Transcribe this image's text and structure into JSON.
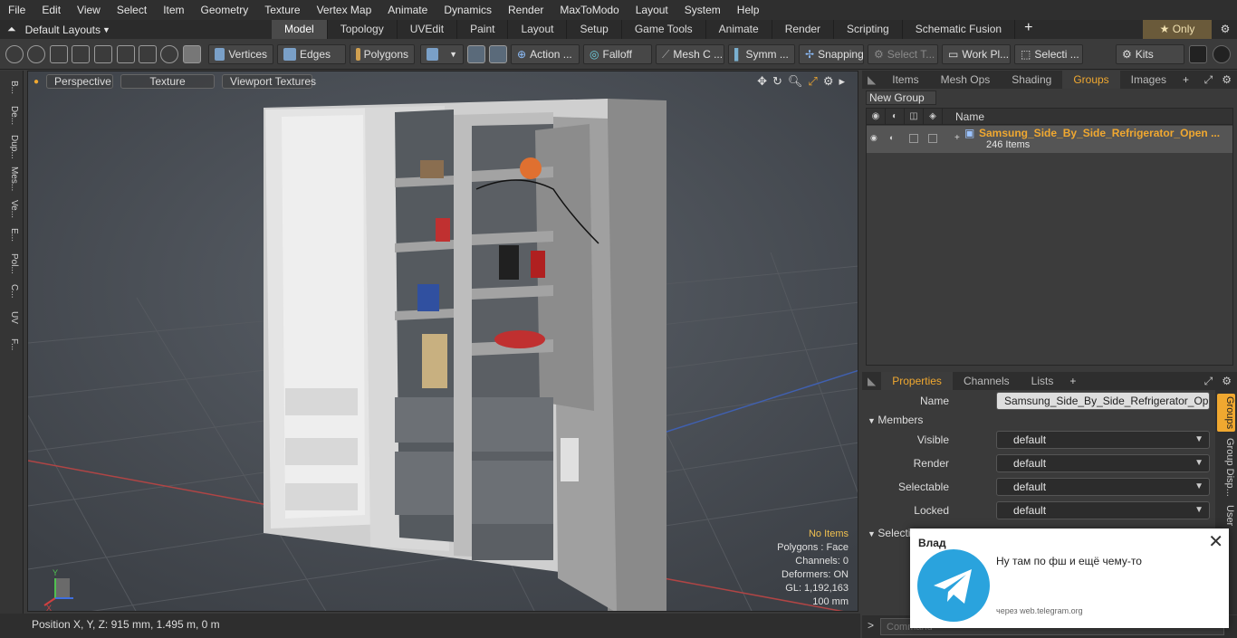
{
  "menu": [
    "File",
    "Edit",
    "View",
    "Select",
    "Item",
    "Geometry",
    "Texture",
    "Vertex Map",
    "Animate",
    "Dynamics",
    "Render",
    "MaxToModo",
    "Layout",
    "System",
    "Help"
  ],
  "layout": {
    "label": "Default Layouts"
  },
  "tabs": [
    "Model",
    "Topology",
    "UVEdit",
    "Paint",
    "Layout",
    "Setup",
    "Game Tools",
    "Animate",
    "Render",
    "Scripting",
    "Schematic Fusion"
  ],
  "only_label": "Only",
  "toolbar": {
    "vertices": "Vertices",
    "edges": "Edges",
    "polygons": "Polygons",
    "action": "Action ...",
    "falloff": "Falloff",
    "meshc": "Mesh C ...",
    "symm": "Symm ...",
    "snapping": "Snapping",
    "select_t": "Select T...",
    "workpl": "Work Pl...",
    "selecti": "Selecti ...",
    "kits": "Kits"
  },
  "left_strip": [
    "B...",
    "De...",
    "Dup...",
    "Mes...",
    "Ve...",
    "E...",
    "Pol...",
    "C...",
    "UV",
    "F..."
  ],
  "viewport": {
    "perspective": "Perspective",
    "texture": "Texture",
    "viewport_textures": "Viewport Textures",
    "info": {
      "no_items": "No Items",
      "polygons": "Polygons : Face",
      "channels": "Channels: 0",
      "deformers": "Deformers: ON",
      "gl": "GL: 1,192,163",
      "scale": "100 mm"
    }
  },
  "right_tabs": [
    "Items",
    "Mesh Ops",
    "Shading",
    "Groups",
    "Images"
  ],
  "new_group": "New Group",
  "group_list": {
    "header_name": "Name",
    "row_name": "Samsung_Side_By_Side_Refrigerator_Open ...",
    "row_count": "246 Items"
  },
  "props_tabs": [
    "Properties",
    "Channels",
    "Lists"
  ],
  "properties": {
    "name_label": "Name",
    "name_value": "Samsung_Side_By_Side_Refrigerator_Open_wi",
    "members_label": "Members",
    "visible_label": "Visible",
    "render_label": "Render",
    "selectable_label": "Selectable",
    "locked_label": "Locked",
    "default_value": "default",
    "selection_label": "Selection Setting"
  },
  "side_tabs": [
    "Groups",
    "Group Disp...",
    "User"
  ],
  "status": {
    "position": "Position X, Y, Z:   915 mm, 1.495 m, 0 m"
  },
  "command_placeholder": "Command",
  "notification": {
    "sender": "Влад",
    "message": "Ну там по фш и ещё чему-то",
    "via": "через web.telegram.org"
  }
}
